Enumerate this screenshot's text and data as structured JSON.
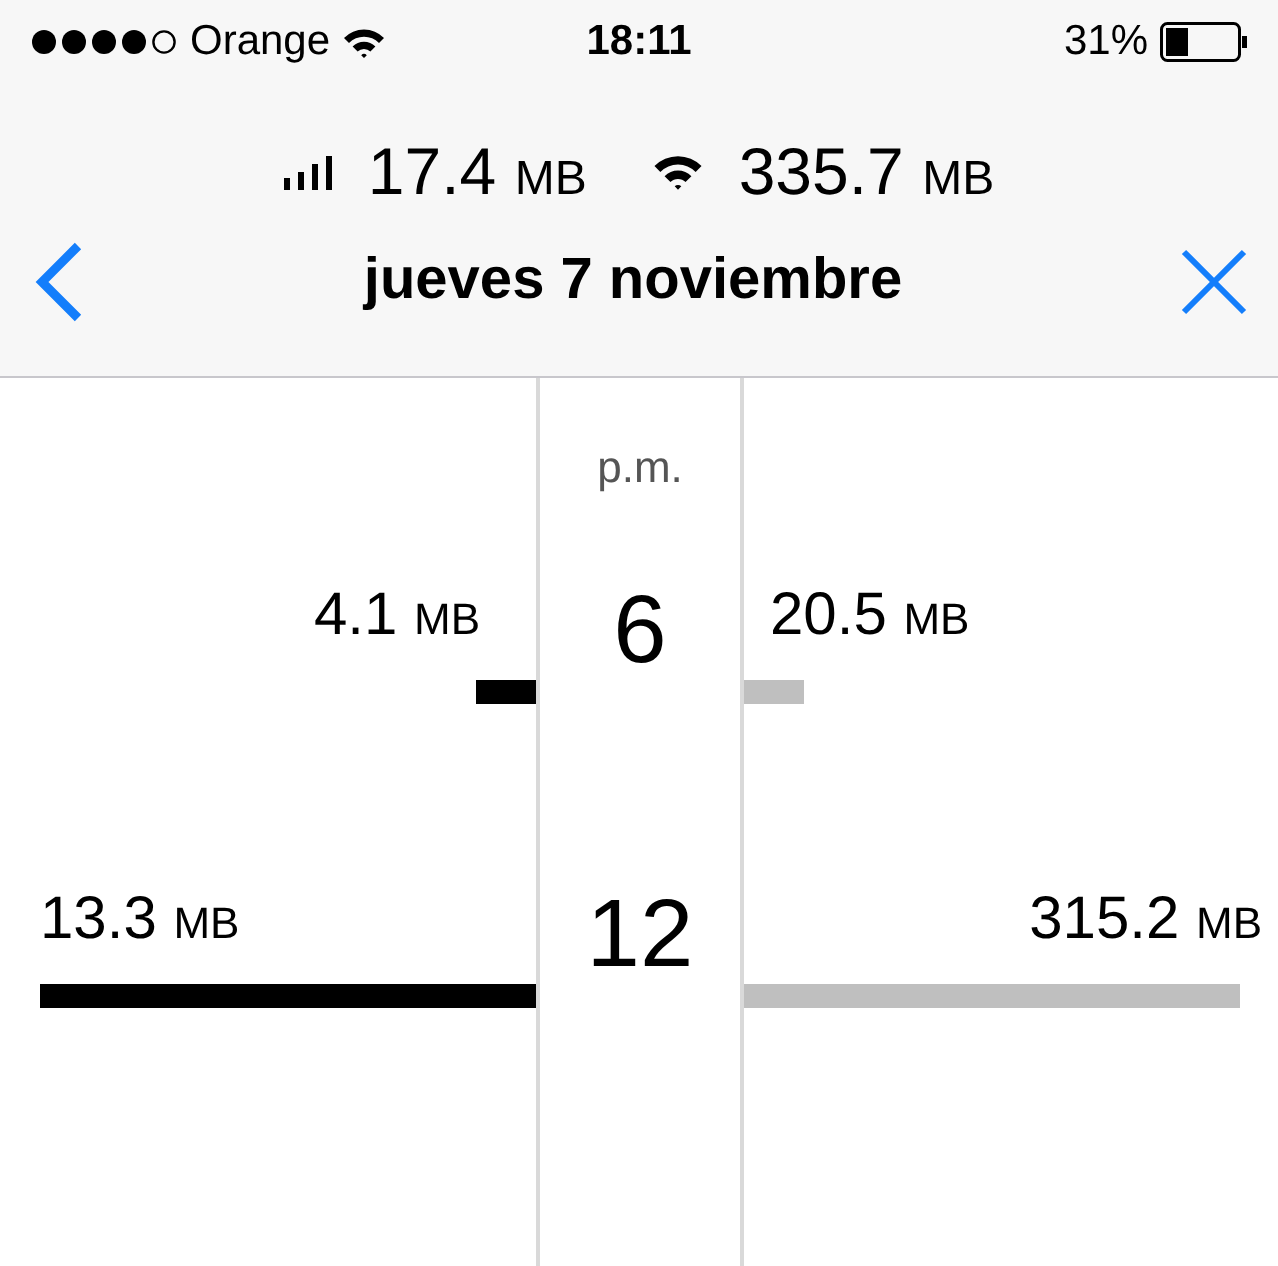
{
  "status_bar": {
    "carrier": "Orange",
    "time": "18:11",
    "battery": "31%"
  },
  "totals": [
    {
      "kind": "cellular",
      "value": "17.4",
      "unit": "MB"
    },
    {
      "kind": "wifi",
      "value": "335.7",
      "unit": "MB"
    }
  ],
  "nav": {
    "title": "jueves 7 noviembre"
  },
  "period": "p.m.",
  "hours": [
    {
      "hour": "6",
      "cellular": {
        "value": "4.1",
        "unit": "MB",
        "kind": "short"
      },
      "wifi": {
        "value": "20.5",
        "unit": "MB",
        "kind": "short"
      }
    },
    {
      "hour": "12",
      "cellular": {
        "value": "13.3",
        "unit": "MB",
        "kind": "full"
      },
      "wifi": {
        "value": "315.2",
        "unit": "MB",
        "kind": "full"
      }
    }
  ]
}
